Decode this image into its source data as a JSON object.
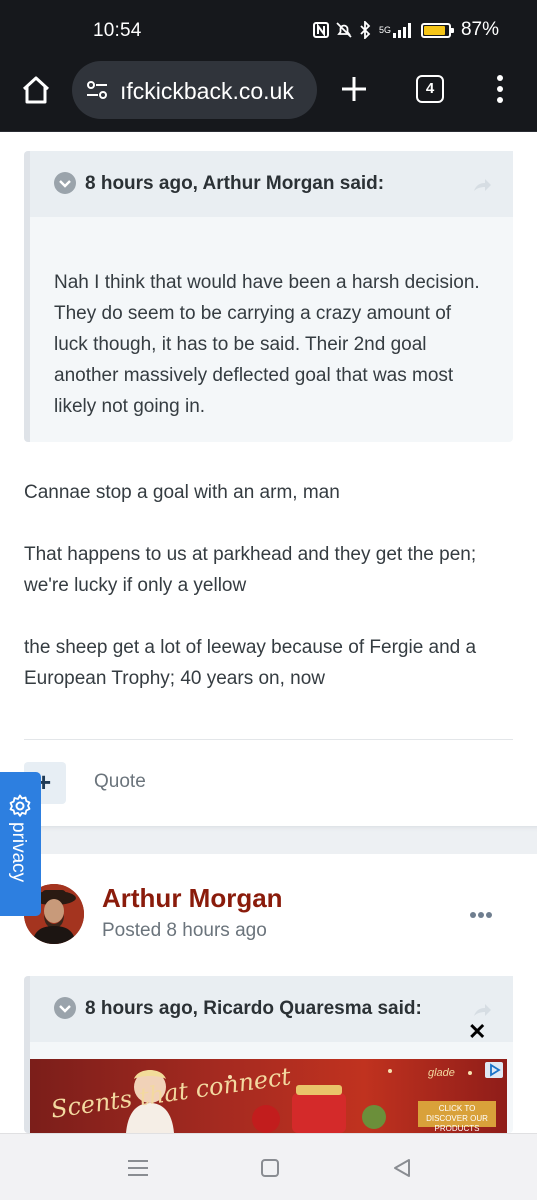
{
  "status_bar": {
    "time": "10:54",
    "network": "5G",
    "battery_percent_label": "87%",
    "battery_level": 0.87,
    "icons": [
      "nfc-icon",
      "mute-icon",
      "bluetooth-icon",
      "signal-icon",
      "battery-icon"
    ]
  },
  "browser": {
    "url": "ıfckickback.co.uk",
    "tab_count": "4",
    "icons": [
      "home-icon",
      "site-settings-icon",
      "plus-icon",
      "tabs-icon",
      "menu-icon"
    ]
  },
  "post": {
    "quote": {
      "citation": "8 hours ago, Arthur Morgan said:",
      "text": "Nah I think that would have been a harsh decision. They do seem to be carrying a crazy amount of luck though, it has to be said. Their 2nd goal another massively deflected goal that was most likely not going in."
    },
    "paragraphs": [
      "Cannae stop a goal with an arm, man",
      "That happens to us at parkhead and they get the pen; we're lucky if only a yellow",
      "the sheep get a lot of leeway because of Fergie and a European Trophy; 40 years on, now"
    ],
    "reputation_button": "+",
    "quote_label": "Quote"
  },
  "next_post": {
    "author": "Arthur Morgan",
    "posted": "Posted 8 hours ago",
    "quote_citation": "8 hours ago, Ricardo Quaresma said:"
  },
  "ad": {
    "tagline": "Scents that connect",
    "brand": "glade",
    "cta": "CLICK TO DISCOVER OUR PRODUCTS",
    "close": "✕"
  },
  "privacy": {
    "label": "privacy"
  },
  "colors": {
    "author_name": "#8a1b0b",
    "privacy_tab": "#2d7fe0",
    "quote_bg": "#f4f7f9"
  }
}
